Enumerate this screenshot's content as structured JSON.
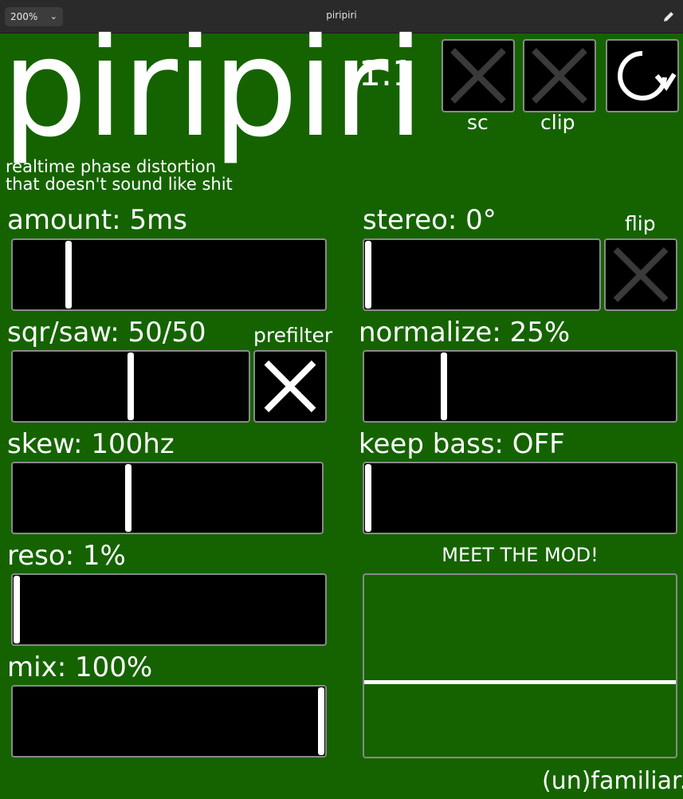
{
  "window": {
    "title": "piripiri",
    "zoom": "200%",
    "zoom_chevron": "chevron-down-icon",
    "edit_icon": "pencil-icon"
  },
  "header": {
    "logo": "piripiri",
    "version": "1.1",
    "tagline_line1": "realtime phase distortion",
    "tagline_line2": "that doesn't sound like shit",
    "toggles": [
      {
        "label": "sc",
        "state": "off"
      },
      {
        "label": "clip",
        "state": "off"
      }
    ],
    "reset_icon": "refresh-icon"
  },
  "params": {
    "amount": {
      "label": "amount: 5ms",
      "value": 0.17
    },
    "sqr_saw": {
      "label": "sqr/saw: 50/50",
      "value": 0.5
    },
    "prefilter": {
      "label": "prefilter",
      "state": "on"
    },
    "skew": {
      "label": "skew: 100hz",
      "value": 0.37
    },
    "reso": {
      "label": "reso: 1%",
      "value": 0.0
    },
    "mix": {
      "label": "mix: 100%",
      "value": 1.0
    },
    "stereo": {
      "label": "stereo: 0°",
      "value": 0.0
    },
    "flip": {
      "label": "flip",
      "state": "off"
    },
    "normalize": {
      "label": "normalize: 25%",
      "value": 0.25
    },
    "keep_bass": {
      "label": "keep bass: OFF",
      "value": 0.0
    }
  },
  "mod": {
    "title": "MEET THE MOD!",
    "level": 0.5
  },
  "footer": {
    "brand": "(un)familiar."
  },
  "colors": {
    "background": "#156300",
    "panel": "#000000",
    "toggle_off": "#3a3a3a",
    "toggle_on": "#ffffff"
  }
}
